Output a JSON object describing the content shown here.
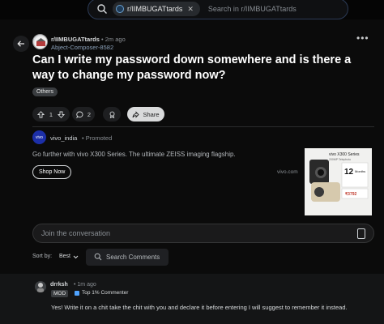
{
  "search": {
    "chip_label": "r/IIMBUGATtards",
    "placeholder": "Search in r/IIMBUGATtards"
  },
  "post": {
    "subreddit": "r/IIMBUGATtards",
    "time": "2m ago",
    "author": "Abject-Composer-8582",
    "title": "Can I write my password down somewhere and is there a way to change my password now?",
    "flair": "Others",
    "votes": "1",
    "comments": "2",
    "share_label": "Share"
  },
  "ad": {
    "advertiser": "vivo_india",
    "promoted_label": "Promoted",
    "headline": "Go further with vivo X300 Series. The ultimate ZEISS imaging flagship.",
    "cta": "Shop Now",
    "domain": "vivo.com",
    "logo_text": "vivo",
    "image": {
      "brand": "vivo X300 Series",
      "sub": "200MP Telephoto",
      "offer_big": "12",
      "offer_text": "Months",
      "price": "₹3792"
    }
  },
  "composer": {
    "placeholder": "Join the conversation"
  },
  "sort": {
    "label": "Sort by:",
    "value": "Best",
    "search_placeholder": "Search Comments"
  },
  "comment": {
    "user": "drrksh",
    "time": "1m ago",
    "mod_label": "MOD",
    "badge": "Top 1% Commenter",
    "body": "Yes! Write it on a chit take the chit with you and declare it before entering I will suggest to remember it instead."
  },
  "colors": {
    "background": "#0b0b0b",
    "accent_blue": "#4fa3ff",
    "share_button": "#d9dadb"
  }
}
